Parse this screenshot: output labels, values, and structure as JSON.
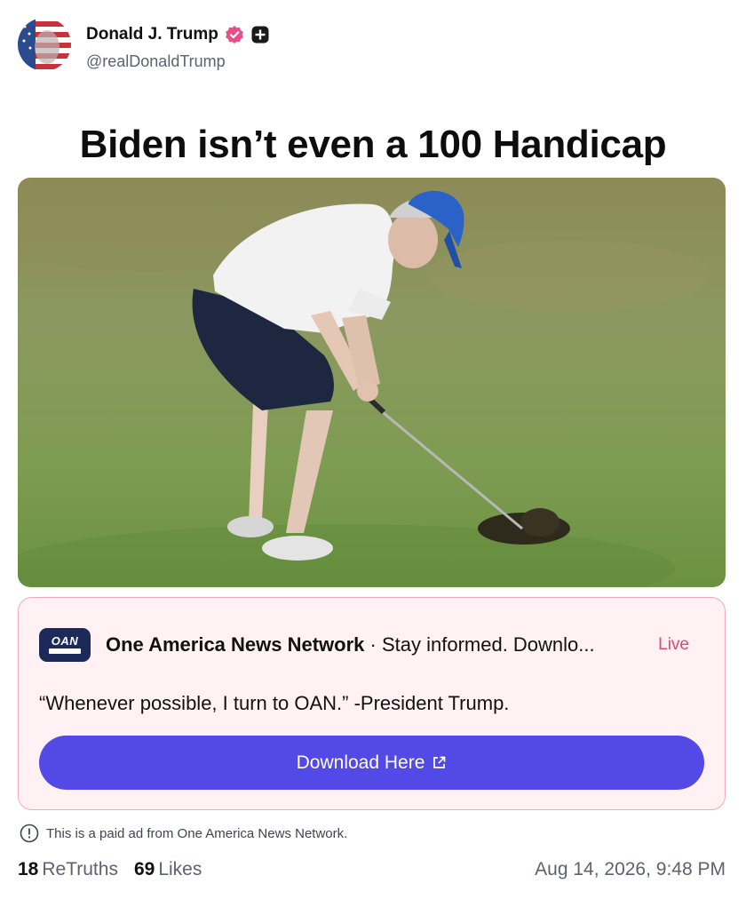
{
  "author": {
    "display_name": "Donald J. Trump",
    "handle": "@realDonaldTrump",
    "verified_icon": "verified-badge-icon",
    "plus_icon": "plus-badge-icon"
  },
  "post": {
    "text": "Biden isn’t even a 100 Handicap"
  },
  "ad": {
    "logo_text": "OAN",
    "source_name": "One America News Network",
    "separator": " · ",
    "description": "Stay informed. Downlo...",
    "live_label": "Live",
    "quote": "“Whenever possible, I turn to OAN.” -President Trump.",
    "button_label": "Download Here",
    "button_icon": "external-link-icon",
    "disclaimer": "This is a paid ad from One America News Network."
  },
  "stats": {
    "retruths_count": "18",
    "retruths_label": "ReTruths",
    "likes_count": "69",
    "likes_label": "Likes",
    "timestamp": "Aug 14, 2026, 9:48 PM"
  },
  "colors": {
    "accent": "#5249e6",
    "ad_background": "#fff1f4",
    "ad_border": "#f2a9bd",
    "live_color": "#e2457a",
    "verified_color": "#e84d8a"
  }
}
